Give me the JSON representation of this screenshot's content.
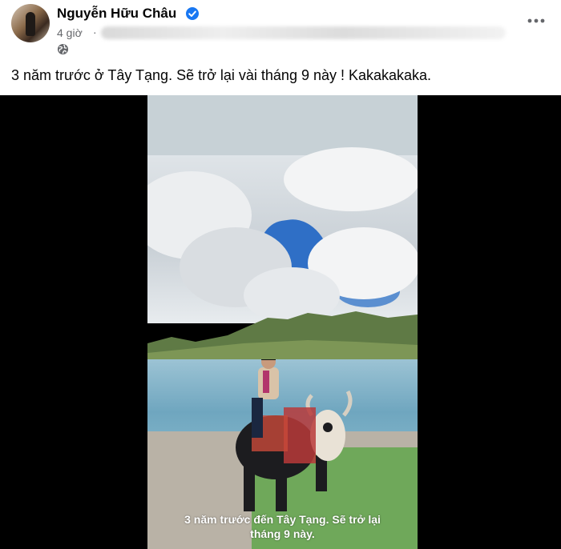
{
  "post": {
    "author": "Nguyễn Hữu Châu",
    "time": "4 giờ",
    "separator": "·",
    "caption": "3 năm trước ở Tây Tạng. Sẽ trở lại vài tháng 9 này ! Kakakakaka."
  },
  "media": {
    "subtitle_line1": "3 năm trước đến Tây Tạng. Sẽ trở lại",
    "subtitle_line2": "tháng 9 này."
  },
  "icons": {
    "verified": "verified-badge-icon",
    "audience": "globe-icon",
    "menu": "more-options-icon"
  },
  "colors": {
    "verified": "#1877f2",
    "meta_text": "#65676b",
    "text": "#050505"
  }
}
